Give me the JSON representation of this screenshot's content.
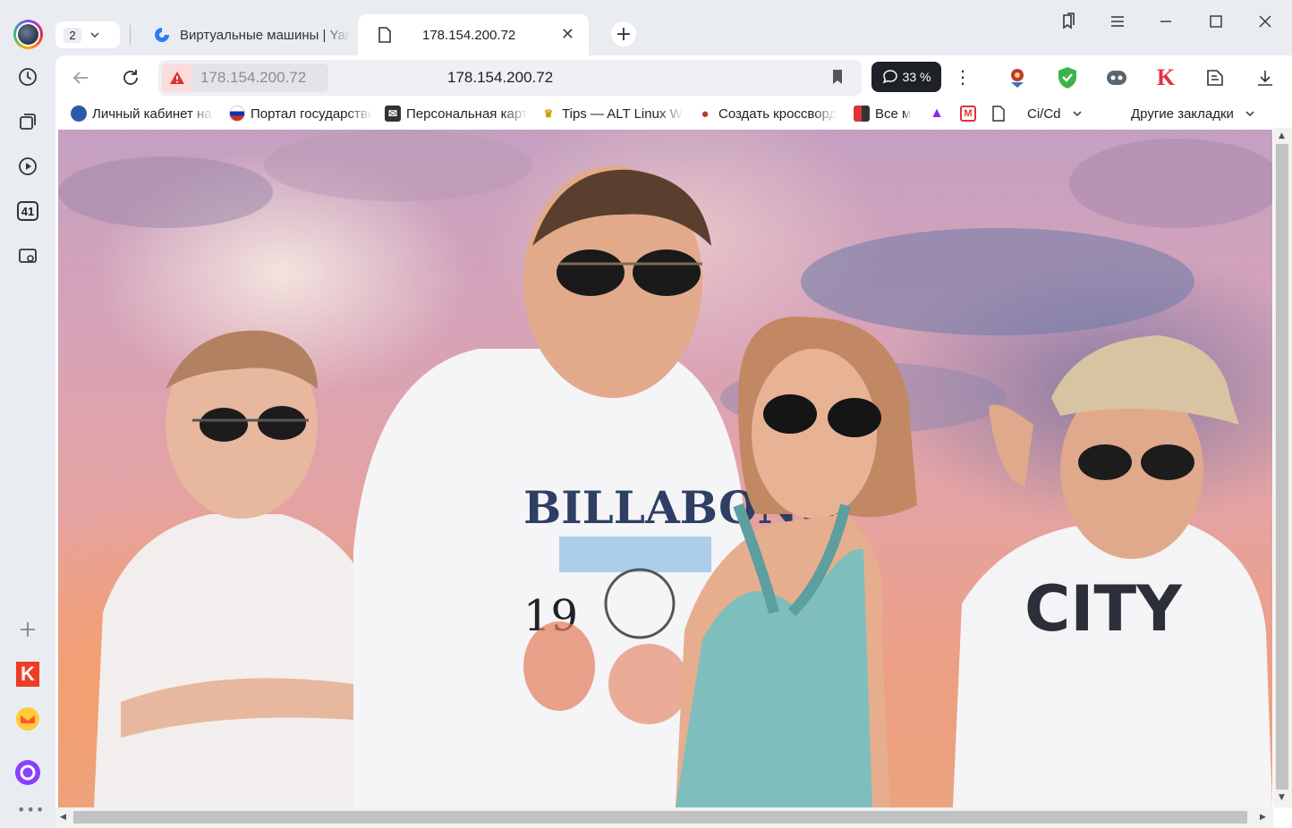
{
  "tabs": {
    "count": "2",
    "items": [
      {
        "label": "Виртуальные машины | Yandex"
      },
      {
        "label": "178.154.200.72"
      }
    ]
  },
  "toolbar": {
    "address_chip": "178.154.200.72",
    "url": "178.154.200.72",
    "zoom": "33 %"
  },
  "sidebar": {
    "tabs_badge": "41",
    "k_letter": "K",
    "more": "•••"
  },
  "extensions": {
    "kinopoisk_letter": "K"
  },
  "bookmarks": {
    "items": [
      {
        "label": "Личный кабинет налогоплательщика"
      },
      {
        "label": "Портал государственных услуг"
      },
      {
        "label": "Персональная карта"
      },
      {
        "label": "Tips — ALT Linux Wiki"
      },
      {
        "label": "Создать кроссворд"
      },
      {
        "label": "Все м"
      },
      {
        "label": "Ci/Cd"
      }
    ],
    "other": "Другие закладки"
  },
  "colors": {
    "accent": "#2d7cf6",
    "warning": "#e03131",
    "zoom_pill": "#1e2128"
  }
}
